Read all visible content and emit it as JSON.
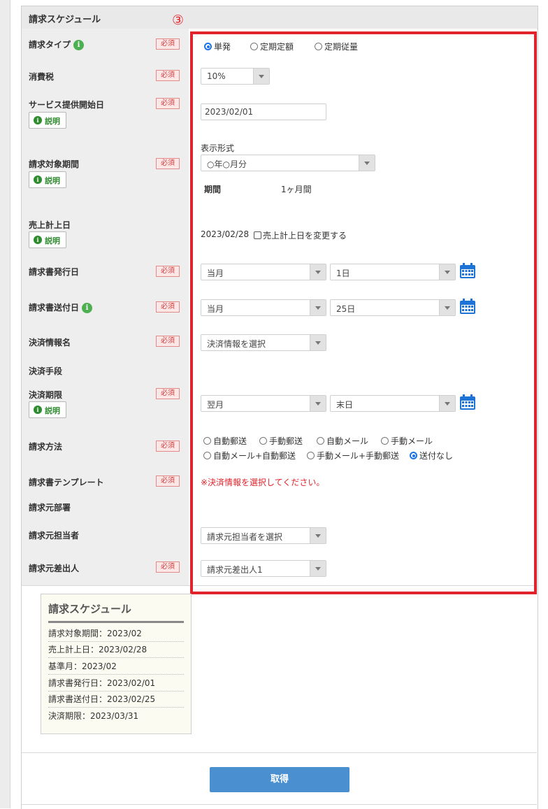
{
  "panel_title": "請求スケジュール",
  "annotation": "③",
  "required_label": "必須",
  "desc_label": "説明",
  "info_glyph": "i",
  "rows": {
    "billing_type": {
      "label": "請求タイプ",
      "options": [
        "単発",
        "定期定額",
        "定期従量"
      ],
      "selected": "単発"
    },
    "tax": {
      "label": "消費税",
      "value": "10%"
    },
    "service_start": {
      "label": "サービス提供開始日",
      "value": "2023/02/01"
    },
    "period": {
      "label": "請求対象期間",
      "format_label": "表示形式",
      "format_value": "○年○月分",
      "period_label": "期間",
      "period_value": "1ヶ月間"
    },
    "sales_date": {
      "label": "売上計上日",
      "value": "2023/02/28",
      "checkbox_label": "売上計上日を変更する"
    },
    "issue_date": {
      "label": "請求書発行日",
      "month": "当月",
      "day": "1日"
    },
    "send_date": {
      "label": "請求書送付日",
      "month": "当月",
      "day": "25日"
    },
    "payment_info": {
      "label": "決済情報名",
      "placeholder": "決済情報を選択"
    },
    "payment_method": {
      "label": "決済手段"
    },
    "payment_deadline": {
      "label": "決済期限",
      "month": "翌月",
      "day": "末日"
    },
    "billing_method": {
      "label": "請求方法",
      "options_row1": [
        "自動郵送",
        "手動郵送",
        "自動メール",
        "手動メール"
      ],
      "options_row2": [
        "自動メール+自動郵送",
        "手動メール+手動郵送",
        "送付なし"
      ],
      "selected": "送付なし"
    },
    "template": {
      "label": "請求書テンプレート",
      "message": "※決済情報を選択してください。"
    },
    "department": {
      "label": "請求元部署"
    },
    "person": {
      "label": "請求元担当者",
      "placeholder": "請求元担当者を選択"
    },
    "sender": {
      "label": "請求元差出人",
      "value": "請求元差出人1"
    }
  },
  "summary": {
    "title": "請求スケジュール",
    "items": [
      "請求対象期間：2023/02",
      "売上計上日：2023/02/28",
      "基準月：2023/02",
      "請求書発行日：2023/02/01",
      "請求書送付日：2023/02/25",
      "決済期限：2023/03/31"
    ]
  },
  "submit_label": "取得",
  "colors": {
    "accent_red": "#e1242b",
    "button_blue": "#4a90d0",
    "radio_blue": "#1a73e8",
    "info_green": "#4caf50"
  }
}
